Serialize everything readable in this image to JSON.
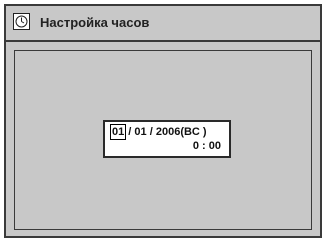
{
  "window": {
    "title": "Настройка часов",
    "icon": "clock-icon"
  },
  "clock": {
    "month": "01",
    "sep1": " / ",
    "day": "01",
    "sep2": " / ",
    "year_era": "2006(BC )",
    "time": "0 : 00"
  }
}
